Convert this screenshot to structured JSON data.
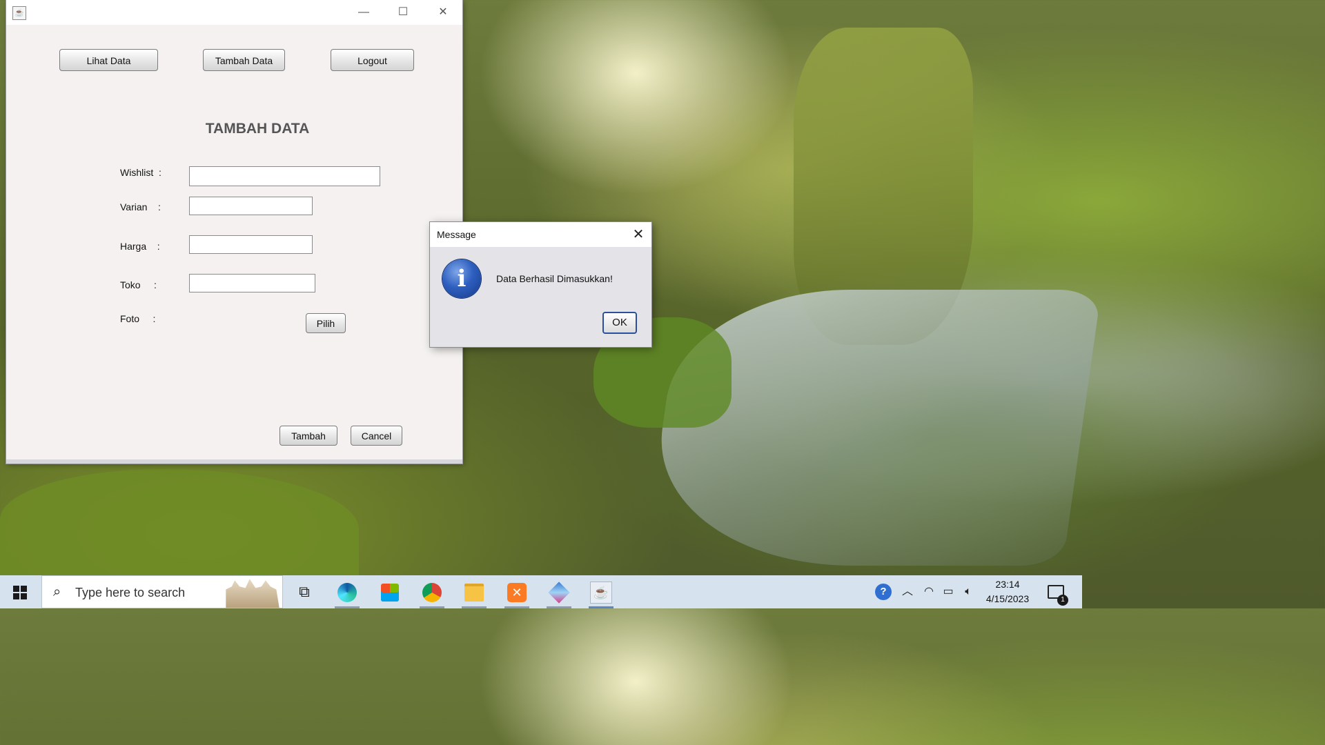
{
  "main_window": {
    "title_icon": "java-cup-icon",
    "controls": {
      "minimize": "—",
      "maximize": "☐",
      "close": "✕"
    },
    "nav_buttons": {
      "lihat_data": "Lihat Data",
      "tambah_data": "Tambah Data",
      "logout": "Logout"
    },
    "heading": "TAMBAH DATA",
    "form": {
      "wishlist_label": "Wishlist  :",
      "varian_label": "Varian    :",
      "harga_label": "Harga    :",
      "toko_label": "Toko     :",
      "foto_label": "Foto     :",
      "wishlist_value": "",
      "varian_value": "",
      "harga_value": "",
      "toko_value": "",
      "pilih_button": "Pilih"
    },
    "actions": {
      "tambah": "Tambah",
      "cancel": "Cancel"
    }
  },
  "dialog": {
    "title": "Message",
    "close": "✕",
    "icon": "i",
    "message": "Data Berhasil Dimasukkan!",
    "ok": "OK"
  },
  "taskbar": {
    "search_placeholder": "Type here to search",
    "clock_time": "23:14",
    "clock_date": "4/15/2023",
    "notification_count": "1",
    "apps": [
      "task-view-icon",
      "edge-icon",
      "store-icon",
      "chrome-icon",
      "file-explorer-icon",
      "xampp-icon",
      "virtualbox-icon",
      "java-icon"
    ]
  }
}
